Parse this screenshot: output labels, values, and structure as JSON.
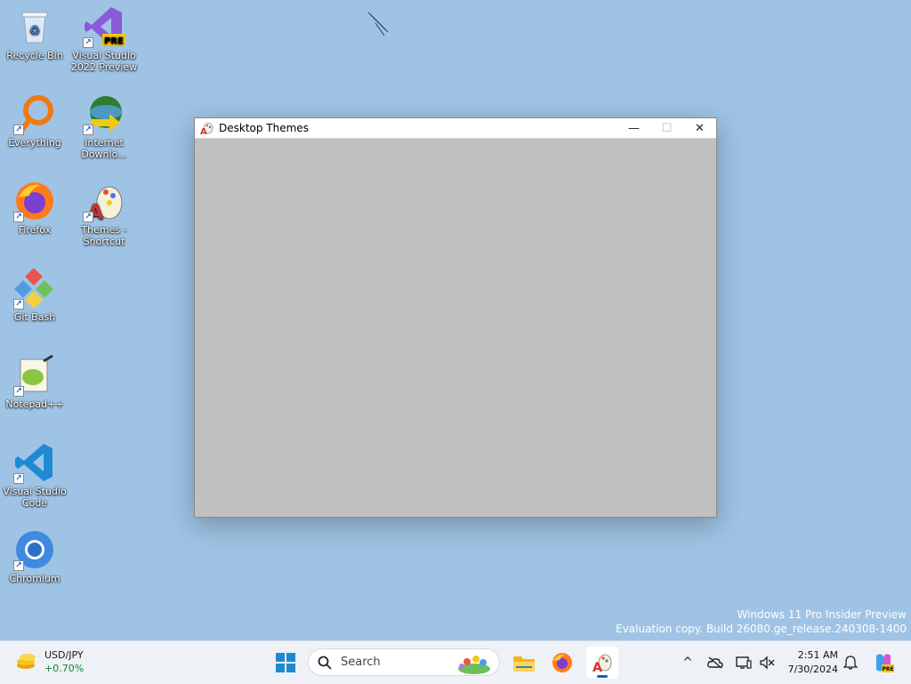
{
  "desktop": {
    "icons": [
      {
        "label": "Recycle Bin"
      },
      {
        "label": "Visual Studio 2022 Preview"
      },
      {
        "label": "Everything"
      },
      {
        "label": "Internet Downlo..."
      },
      {
        "label": "Firefox"
      },
      {
        "label": "Themes - Shortcut"
      },
      {
        "label": "Git Bash"
      },
      {
        "label": "Notepad++"
      },
      {
        "label": "Visual Studio Code"
      },
      {
        "label": "Chromium"
      }
    ],
    "pre_badge": "PRE"
  },
  "window": {
    "title": "Desktop Themes",
    "minimize_glyph": "—",
    "maximize_glyph": "☐",
    "close_glyph": "✕",
    "client_color": "#c0c0c0"
  },
  "watermark": {
    "line1": "Windows 11 Pro Insider Preview",
    "line2": "Evaluation copy. Build 26080.ge_release.240308-1400"
  },
  "taskbar": {
    "widget": {
      "pair": "USD/JPY",
      "change": "+0.70%"
    },
    "search_placeholder": "Search",
    "apps": [
      {
        "name": "start",
        "icon": "windows-logo-icon"
      },
      {
        "name": "file-explorer",
        "icon": "folder-icon"
      },
      {
        "name": "firefox",
        "icon": "firefox-icon"
      },
      {
        "name": "desktop-themes",
        "icon": "themes-icon",
        "active": true
      }
    ],
    "tray": {
      "overflow_glyph": "^",
      "time": "2:51 AM",
      "date": "7/30/2024"
    }
  },
  "colors": {
    "desktop_bg": "#9fc3e4",
    "accent": "#0067c0"
  }
}
